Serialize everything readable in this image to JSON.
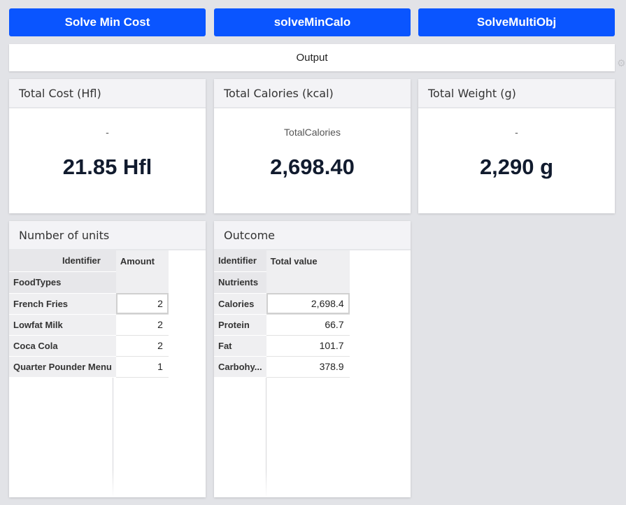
{
  "buttons": {
    "min_cost": "Solve Min Cost",
    "min_calo": "solveMinCalo",
    "multi_obj": "SolveMultiObj"
  },
  "output_label": "Output",
  "kpis": {
    "cost": {
      "title": "Total Cost (Hfl)",
      "subtitle": "-",
      "value": "21.85 Hfl"
    },
    "calories": {
      "title": "Total Calories (kcal)",
      "subtitle": "TotalCalories",
      "value": "2,698.40"
    },
    "weight": {
      "title": "Total Weight (g)",
      "subtitle": "-",
      "value": "2,290 g"
    }
  },
  "units_table": {
    "title": "Number of units",
    "identifier_label": "Identifier",
    "index_label": "FoodTypes",
    "column_label": "Amount",
    "rows": [
      {
        "label": "French Fries",
        "value": "2"
      },
      {
        "label": "Lowfat Milk",
        "value": "2"
      },
      {
        "label": "Coca Cola",
        "value": "2"
      },
      {
        "label": "Quarter Pounder Menu",
        "value": "1"
      }
    ]
  },
  "outcome_table": {
    "title": "Outcome",
    "identifier_label": "Identifier",
    "index_label": "Nutrients",
    "column_label": "Total value",
    "rows": [
      {
        "label": "Calories",
        "value": "2,698.4"
      },
      {
        "label": "Protein",
        "value": "66.7"
      },
      {
        "label": "Fat",
        "value": "101.7"
      },
      {
        "label": "Carbohy...",
        "value": "378.9"
      }
    ]
  },
  "colors": {
    "button": "#0a55ff",
    "background": "#e2e3e7"
  },
  "icons": {
    "settings": "gear-icon"
  }
}
